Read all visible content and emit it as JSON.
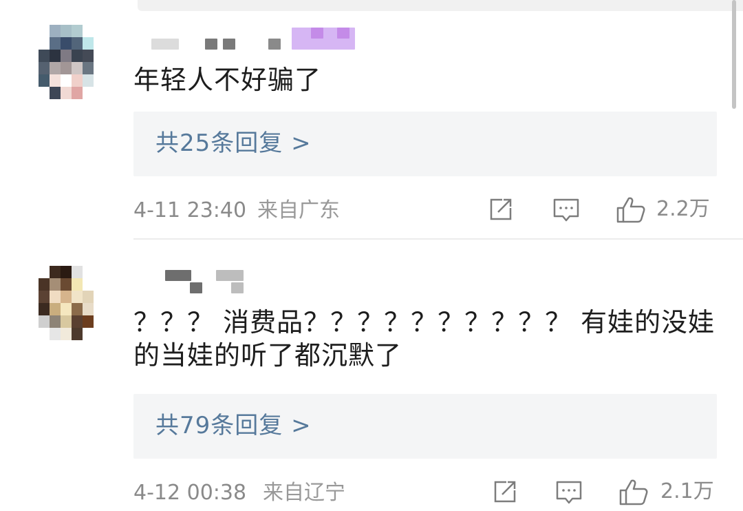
{
  "comments": [
    {
      "text": "年轻人不好骗了",
      "replies_label": "共25条回复 >",
      "time": "4-11 23:40",
      "location": "来自广东",
      "likes": "2.2万"
    },
    {
      "text": "？？？ 消费品？？？？？？？？？？ 有娃的没娃的当娃的听了都沉默了",
      "replies_label": "共79条回复 >",
      "time": "4-12 00:38",
      "location": "来自辽宁",
      "likes": "2.1万"
    }
  ],
  "icons": {
    "share": "share-icon",
    "comment": "comment-icon",
    "like": "thumbs-up-icon"
  },
  "colors": {
    "reply_link": "#56799b",
    "meta_text": "#8a8a8a",
    "reply_box_bg": "#f4f5f6",
    "comment_text": "#1d1d1d"
  }
}
